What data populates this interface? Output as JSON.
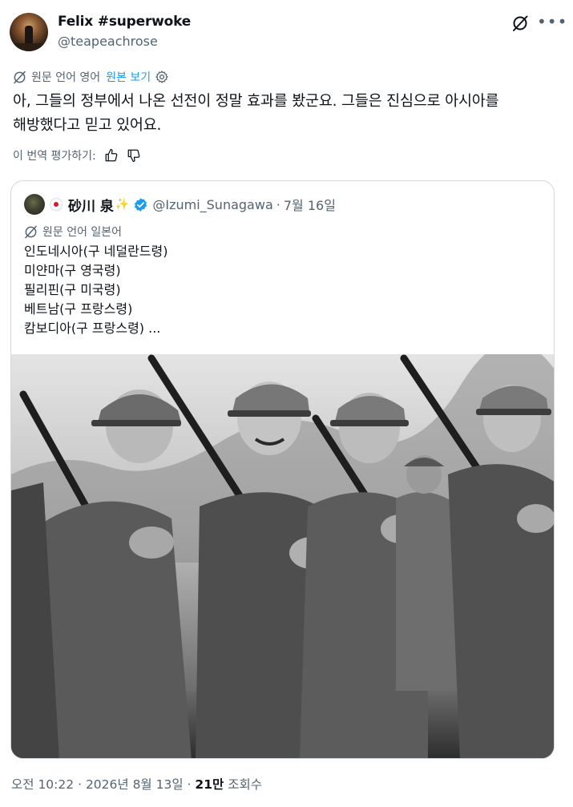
{
  "author": {
    "display_name": "Felix #superwoke",
    "handle": "@teapeachrose"
  },
  "translation_bar": {
    "original_lang": "원문 언어 영어",
    "show_original": "원본 보기"
  },
  "tweet": {
    "line1": "아, 그들의 정부에서 나온 선전이 정말 효과를 봤군요. 그들은 진심으로 아시아를",
    "line2": "해방했다고 믿고 있어요."
  },
  "rate_translation": "이 번역 평가하기:",
  "quote": {
    "display_name": "砂川 泉",
    "deco": "✨",
    "handle": "@Izumi_Sunagawa",
    "separator": "·",
    "date": "7월 16일",
    "original_lang": "원문 언어 일본어",
    "lines": [
      "인도네시아(구 네덜란드령)",
      "미얀마(구 영국령)",
      "필리핀(구 미국령)",
      "베트남(구 프랑스령)",
      "캄보디아(구 프랑스령)  ..."
    ]
  },
  "meta": {
    "time": "오전 10:22",
    "date": "2026년 8월 13일",
    "separator": "·",
    "views_count": "21만",
    "views_label": "조회수"
  },
  "icons": {
    "grok": "grok-icon",
    "more": "more-icon",
    "translate": "translate-icon",
    "settings": "gear-icon",
    "thumbs_up": "thumbs-up-icon",
    "thumbs_down": "thumbs-down-icon",
    "verified": "verified-badge-icon",
    "flag": "japan-flag-icon"
  },
  "colors": {
    "text": "#0f1419",
    "secondary": "#536471",
    "link": "#1d9bf0",
    "border": "#cfd9de"
  }
}
